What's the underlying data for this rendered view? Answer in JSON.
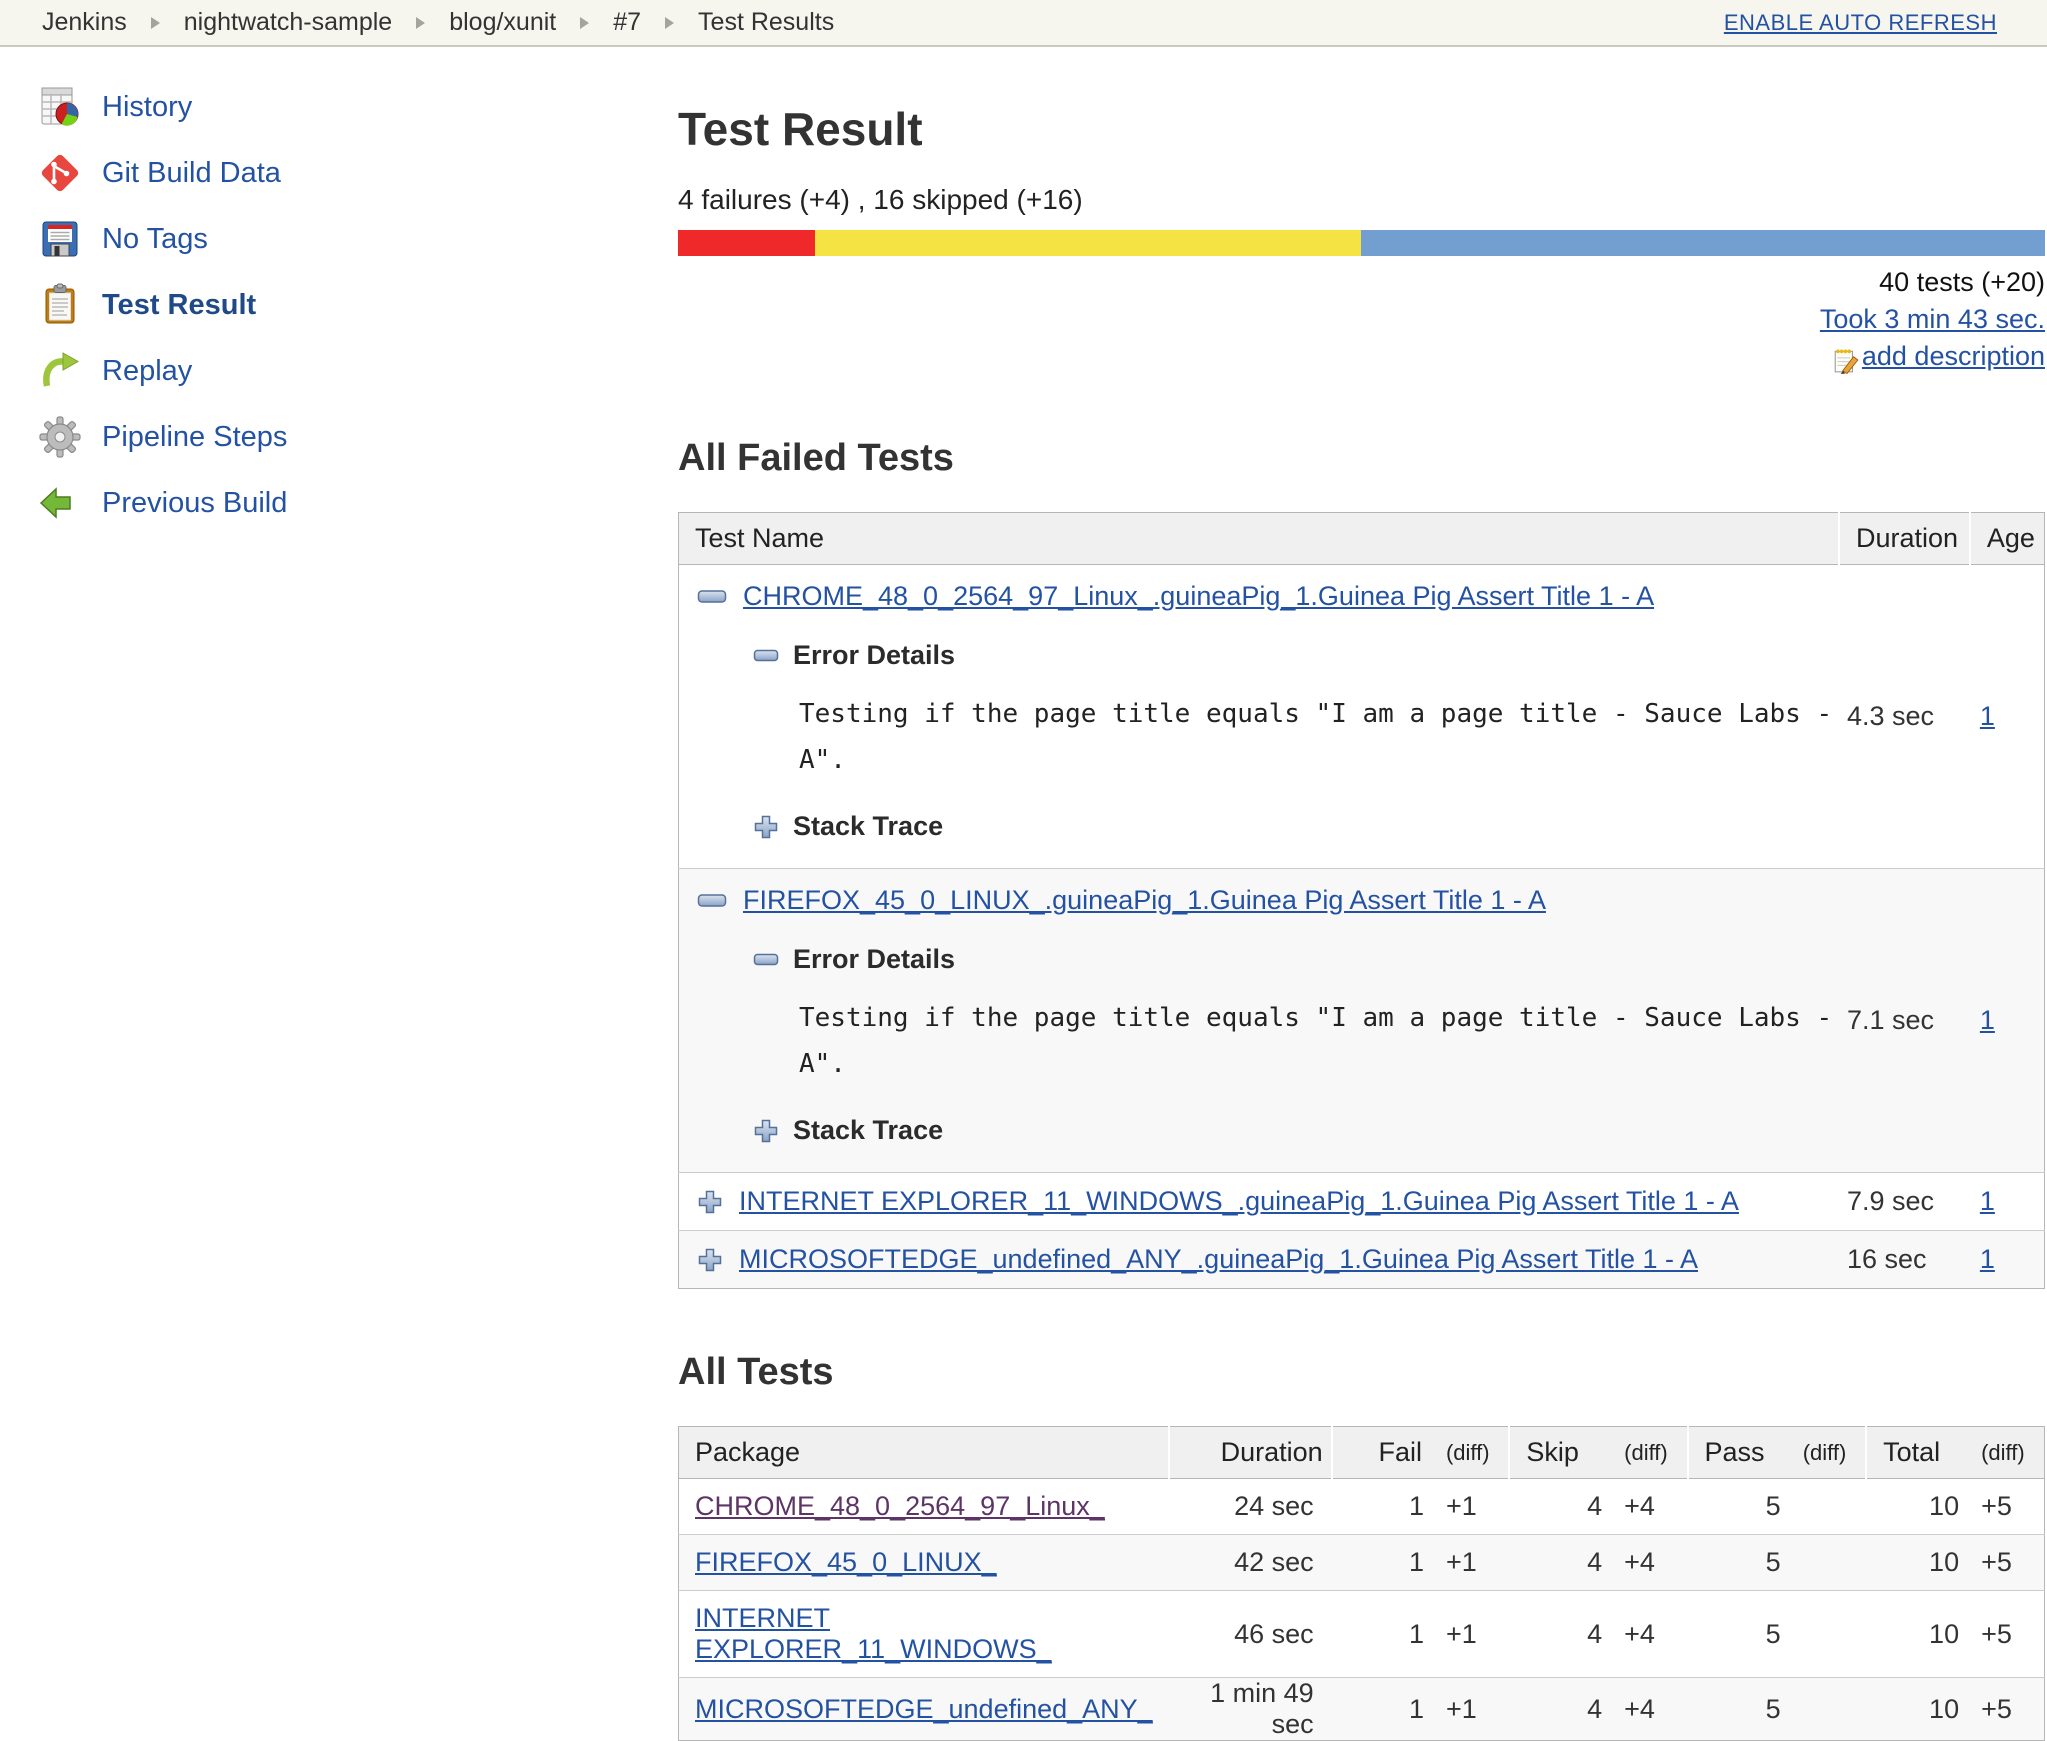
{
  "breadcrumb": {
    "items": [
      "Jenkins",
      "nightwatch-sample",
      "blog/xunit",
      "#7",
      "Test Results"
    ],
    "auto_refresh": "ENABLE AUTO REFRESH"
  },
  "sidebar": {
    "items": [
      {
        "label": "History",
        "icon": "history-icon"
      },
      {
        "label": "Git Build Data",
        "icon": "git-icon"
      },
      {
        "label": "No Tags",
        "icon": "floppy-icon"
      },
      {
        "label": "Test Result",
        "icon": "clipboard-icon",
        "active": true
      },
      {
        "label": "Replay",
        "icon": "replay-icon"
      },
      {
        "label": "Pipeline Steps",
        "icon": "gear-icon"
      },
      {
        "label": "Previous Build",
        "icon": "previous-build-icon"
      }
    ]
  },
  "main": {
    "title": "Test Result",
    "summary": "4 failures (+4) , 16 skipped (+16)",
    "bar": {
      "fail_pct": 10,
      "skip_pct": 40,
      "pass_pct": 50,
      "fail_color": "#ef2929",
      "skip_color": "#f5e344",
      "pass_color": "#729fcf"
    },
    "total_tests": "40 tests (+20)",
    "took": "Took 3 min 43 sec.",
    "add_description": "add description",
    "failed": {
      "heading": "All Failed Tests",
      "columns": {
        "test_name": "Test Name",
        "duration": "Duration",
        "age": "Age"
      },
      "error_details_label": "Error Details",
      "stack_trace_label": "Stack Trace",
      "rows": [
        {
          "name": "CHROME_48_0_2564_97_Linux_.guineaPig_1.Guinea Pig Assert Title 1 - A",
          "expanded": true,
          "error_text": "Testing if the page title equals \"I am a page title - Sauce Labs - A\".",
          "duration": "4.3 sec",
          "age": "1"
        },
        {
          "name": "FIREFOX_45_0_LINUX_.guineaPig_1.Guinea Pig Assert Title 1 - A",
          "expanded": true,
          "error_text": "Testing if the page title equals \"I am a page title - Sauce Labs - A\".",
          "duration": "7.1 sec",
          "age": "1"
        },
        {
          "name": "INTERNET EXPLORER_11_WINDOWS_.guineaPig_1.Guinea Pig Assert Title 1 - A",
          "expanded": false,
          "duration": "7.9 sec",
          "age": "1"
        },
        {
          "name": "MICROSOFTEDGE_undefined_ANY_.guineaPig_1.Guinea Pig Assert Title 1 - A",
          "expanded": false,
          "duration": "16 sec",
          "age": "1"
        }
      ]
    },
    "all_tests": {
      "heading": "All Tests",
      "columns": {
        "package": "Package",
        "duration": "Duration",
        "fail": "Fail",
        "skip": "Skip",
        "pass": "Pass",
        "total": "Total",
        "diff": "(diff)"
      },
      "rows": [
        {
          "package": "CHROME_48_0_2564_97_Linux_",
          "duration": "24 sec",
          "fail": "1",
          "fail_diff": "+1",
          "skip": "4",
          "skip_diff": "+4",
          "pass": "5",
          "pass_diff": "",
          "total": "10",
          "total_diff": "+5"
        },
        {
          "package": "FIREFOX_45_0_LINUX_",
          "duration": "42 sec",
          "fail": "1",
          "fail_diff": "+1",
          "skip": "4",
          "skip_diff": "+4",
          "pass": "5",
          "pass_diff": "",
          "total": "10",
          "total_diff": "+5"
        },
        {
          "package": "INTERNET EXPLORER_11_WINDOWS_",
          "duration": "46 sec",
          "fail": "1",
          "fail_diff": "+1",
          "skip": "4",
          "skip_diff": "+4",
          "pass": "5",
          "pass_diff": "",
          "total": "10",
          "total_diff": "+5"
        },
        {
          "package": "MICROSOFTEDGE_undefined_ANY_",
          "duration": "1 min 49 sec",
          "fail": "1",
          "fail_diff": "+1",
          "skip": "4",
          "skip_diff": "+4",
          "pass": "5",
          "pass_diff": "",
          "total": "10",
          "total_diff": "+5"
        }
      ]
    }
  }
}
